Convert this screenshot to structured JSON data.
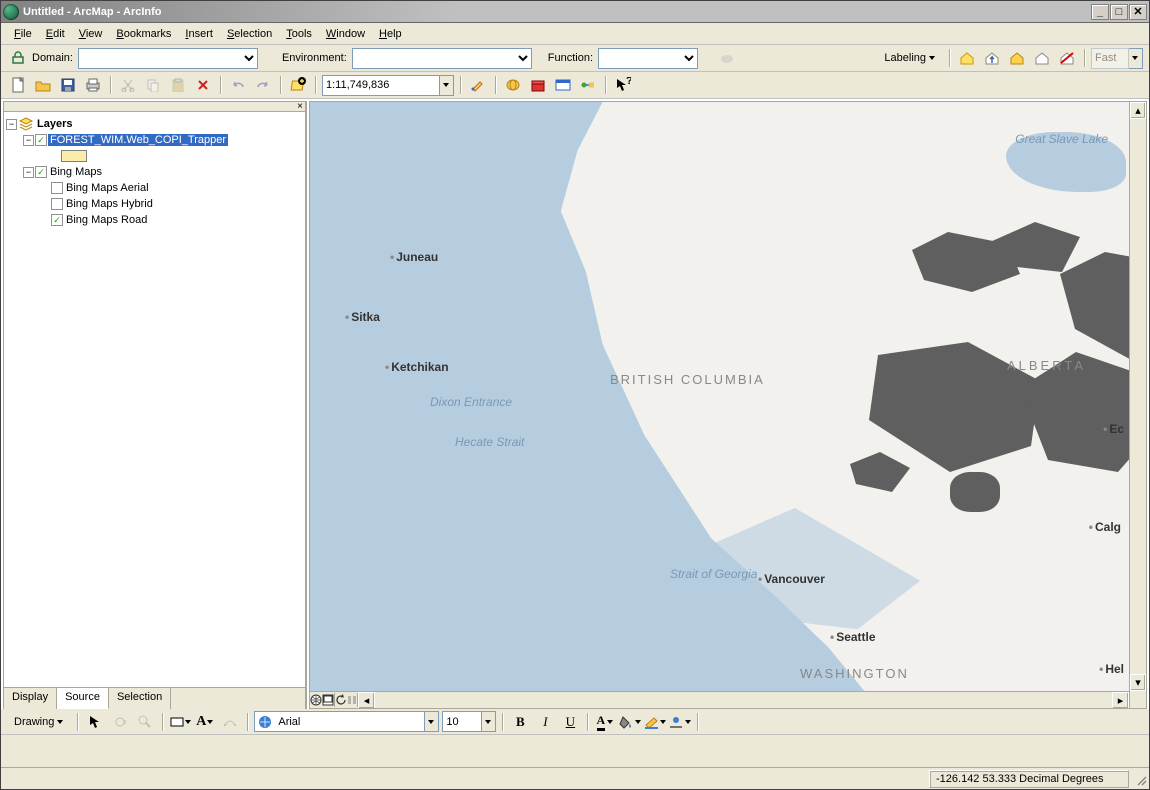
{
  "titlebar": {
    "title": "Untitled - ArcMap - ArcInfo"
  },
  "menus": [
    "File",
    "Edit",
    "View",
    "Bookmarks",
    "Insert",
    "Selection",
    "Tools",
    "Window",
    "Help"
  ],
  "row1": {
    "domain_label": "Domain:",
    "environment_label": "Environment:",
    "function_label": "Function:",
    "labeling_btn": "Labeling",
    "fast_label": "Fast"
  },
  "row2": {
    "scale": "1:11,749,836"
  },
  "toc": {
    "root": "Layers",
    "layer1": "FOREST_WIM.Web_COPI_Trapper",
    "group2": "Bing Maps",
    "bm_aerial": "Bing Maps Aerial",
    "bm_hybrid": "Bing Maps Hybrid",
    "bm_road": "Bing Maps Road",
    "tabs": {
      "display": "Display",
      "source": "Source",
      "selection": "Selection"
    }
  },
  "map_labels": {
    "juneau": "Juneau",
    "sitka": "Sitka",
    "ketchikan": "Ketchikan",
    "vancouver": "Vancouver",
    "seattle": "Seattle",
    "calgary": "Calg",
    "bc": "BRITISH COLUMBIA",
    "alberta": "ALBERTA",
    "washington": "WASHINGTON",
    "dixon": "Dixon Entrance",
    "hecate": "Hecate Strait",
    "georgia": "Strait of Georgia",
    "slave": "Great Slave Lake",
    "ec": "Ec",
    "hel": "Hel"
  },
  "drawing": {
    "label": "Drawing",
    "font": "Arial",
    "size": "10"
  },
  "status": {
    "coords": "-126.142  53.333 Decimal Degrees"
  }
}
